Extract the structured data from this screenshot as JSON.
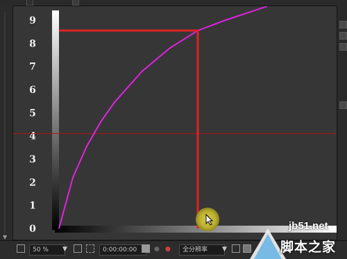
{
  "top_tabs": {
    "left_label": "",
    "right_label": ""
  },
  "viewer": {
    "background": "#363636",
    "guide_color": "#b01616",
    "indicator_color": "#e02222",
    "curve_color": "#e023e0"
  },
  "chart_data": {
    "type": "line",
    "title": "",
    "xlabel": "",
    "ylabel": "",
    "y_ticks": [
      "0",
      "1",
      "2",
      "3",
      "4",
      "5",
      "6",
      "7",
      "8",
      "9"
    ],
    "ylim": [
      0,
      9.6
    ],
    "xlim": [
      0,
      1
    ],
    "x_axis": "black-to-white gradient bar",
    "y_axis": "white-to-black gradient bar",
    "series": [
      {
        "values_x": [
          0,
          0.05,
          0.1,
          0.15,
          0.2,
          0.3,
          0.4,
          0.5,
          0.6,
          0.7,
          0.75
        ],
        "values_y": [
          0,
          2.2,
          3.55,
          4.6,
          5.45,
          6.8,
          7.8,
          8.55,
          9.0,
          9.4,
          9.6
        ]
      }
    ],
    "guide_marker": {
      "x": 0.5,
      "y": 8.55
    },
    "horizontal_reference_y": 4.1
  },
  "bottom_bar": {
    "zoom": "50 %",
    "timecode": "0:00:00:00",
    "resolution": "全分辨率"
  },
  "watermark": {
    "url": "jb51.net",
    "name": "脚本之家"
  }
}
